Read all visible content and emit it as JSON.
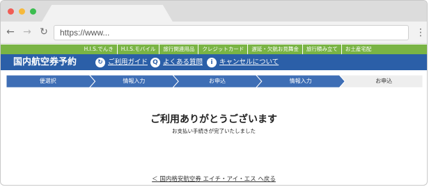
{
  "browser": {
    "url": "https://www..."
  },
  "top_nav": {
    "items": [
      "H.I.S.でんき",
      "H.I.S.モバイル",
      "旅行関連用品",
      "クレジットカード",
      "遅延・欠航お見舞金",
      "旅行積み立て",
      "お土産宅配"
    ]
  },
  "header": {
    "brand": "国内航空券予約",
    "links": {
      "guide": "ご利用ガイド",
      "faq": "よくある質問",
      "cancel": "キャンセルについて"
    },
    "icons": {
      "guide": "guide-icon",
      "faq": "faq-icon",
      "cancel": "info-icon"
    }
  },
  "steps": {
    "items": [
      "便選択",
      "情報入力",
      "お申込",
      "情報入力",
      "お申込"
    ],
    "current_index": 4
  },
  "main": {
    "title": "ご利用ありがとうございます",
    "subtitle": "お支払い手続きが完了いたしました"
  },
  "footer": {
    "back_link": "＜ 国内格安航空券 エイチ・アイ・エス へ戻る"
  },
  "colors": {
    "green_nav": "#7ab445",
    "blue_header": "#2b5fa8",
    "step_active": "#3e6eb5",
    "step_current": "#eeeeee"
  }
}
